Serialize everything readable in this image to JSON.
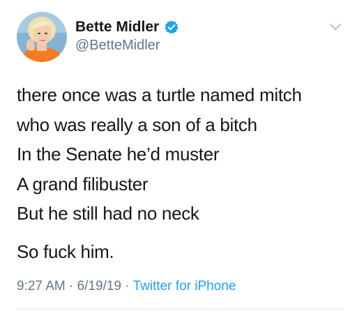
{
  "user": {
    "display_name": "Bette Midler",
    "handle": "@BetteMidler",
    "avatar_icon": "profile-photo",
    "verified_icon": "verified-badge-icon",
    "verified_color": "#1da1f2"
  },
  "tweet": {
    "lines": [
      "there once was a turtle named mitch",
      "who was really a son of a bitch",
      "In the Senate he’d muster",
      "A grand filibuster",
      "But he still had no neck",
      "So fuck him."
    ]
  },
  "meta": {
    "time": "9:27 AM",
    "separator": "·",
    "date": "6/19/19",
    "source": "Twitter for iPhone",
    "link_color": "#1da1f2",
    "muted_color": "#657786"
  },
  "menu": {
    "icon": "chevron-down-icon"
  }
}
